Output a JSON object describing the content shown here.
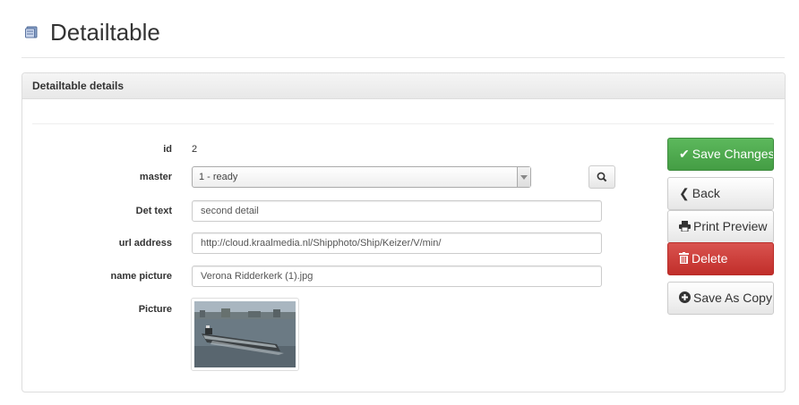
{
  "page": {
    "title": "Detailtable",
    "icon": "table-icon"
  },
  "panel": {
    "title": "Detailtable details"
  },
  "form": {
    "id": {
      "label": "id",
      "value": "2"
    },
    "master": {
      "label": "master",
      "value": "1 - ready"
    },
    "det_text": {
      "label": "Det text",
      "value": "second detail"
    },
    "url_address": {
      "label": "url address",
      "value": "http://cloud.kraalmedia.nl/Shipphoto/Ship/Keizer/V/min/"
    },
    "name_picture": {
      "label": "name picture",
      "value": "Verona Ridderkerk (1).jpg"
    },
    "picture": {
      "label": "Picture"
    }
  },
  "actions": {
    "save_changes": "Save Changes",
    "back": "Back",
    "print_preview": "Print Preview",
    "delete": "Delete",
    "save_as_copy": "Save As Copy"
  },
  "colors": {
    "success": "#5cb85c",
    "danger": "#d9534f"
  }
}
